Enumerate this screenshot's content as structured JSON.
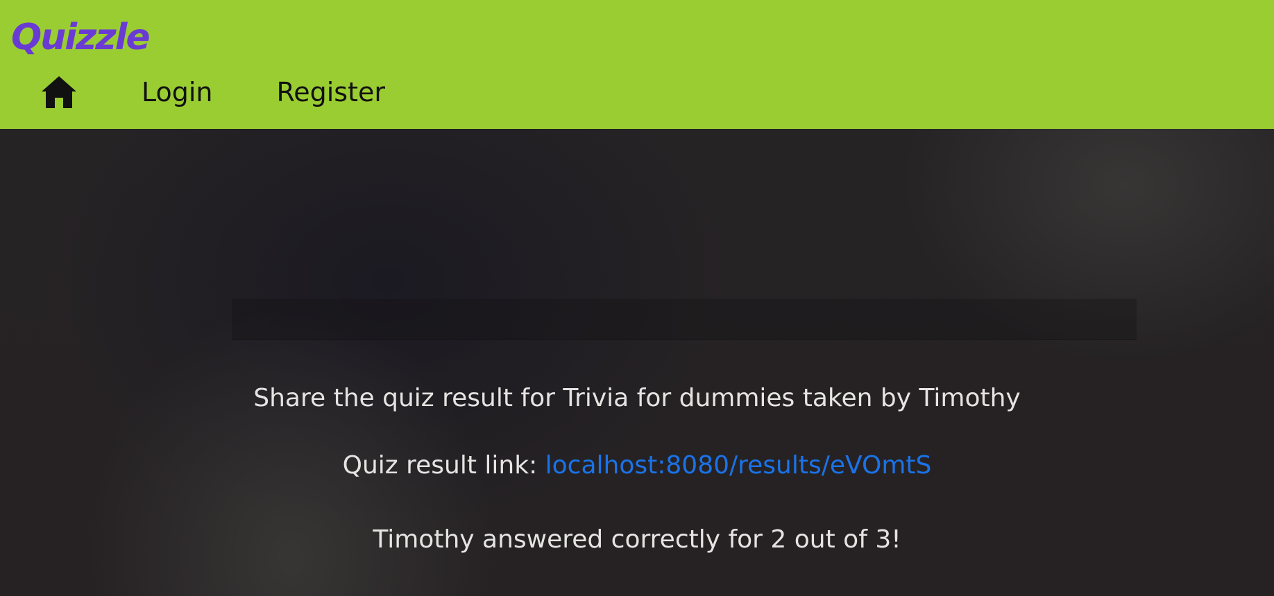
{
  "brand": {
    "name": "Quizzle",
    "color": "#6a3bd4"
  },
  "nav": {
    "home_icon": "home-icon",
    "login_label": "Login",
    "register_label": "Register",
    "background": "#9acd32"
  },
  "result": {
    "share_text": "Share the quiz result for Trivia for dummies taken by Timothy",
    "link_label": "Quiz result link: ",
    "link_text": "localhost:8080/results/eVOmtS",
    "score_text": "Timothy answered correctly for 2 out of 3!",
    "link_color": "#1a73e8"
  }
}
